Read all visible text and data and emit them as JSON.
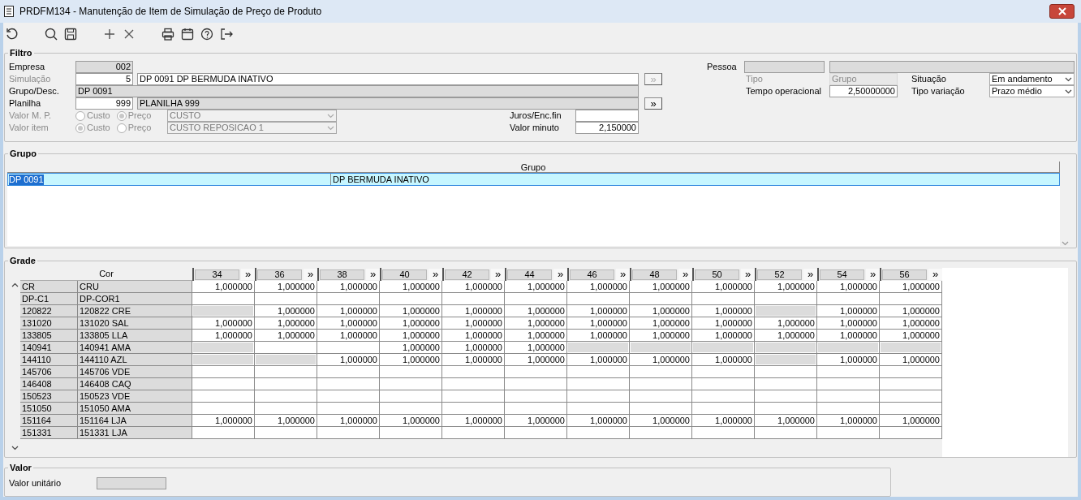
{
  "window": {
    "title": "PRDFM134 - Manutenção de Item de Simulação de Preço de Produto"
  },
  "filtro": {
    "title": "Filtro",
    "empresa": {
      "label": "Empresa",
      "value": "002",
      "disabled": false
    },
    "simulacao": {
      "label": "Simulação",
      "disabled": true,
      "value": "5",
      "description": "DP 0091 DP BERMUDA INATIVO",
      "button": {
        "label": "»",
        "disabled": true
      }
    },
    "grupo": {
      "label": "Grupo/Desc.",
      "disabled": false,
      "value": "DP 0091"
    },
    "planilha": {
      "label": "Planilha",
      "disabled": false,
      "value": "999",
      "description": "PLANILHA 999",
      "button": {
        "label": "»",
        "disabled": false
      }
    },
    "valor_mp": {
      "label": "Valor M. P.",
      "disabled": true,
      "options": [
        {
          "label": "Custo",
          "selected": false
        },
        {
          "label": "Preço",
          "selected": true
        }
      ],
      "dropdown": "CUSTO"
    },
    "valor_item": {
      "label": "Valor item",
      "disabled": true,
      "options": [
        {
          "label": "Custo",
          "selected": true
        },
        {
          "label": "Preço",
          "selected": false
        }
      ],
      "dropdown": "CUSTO REPOSICAO 1"
    },
    "juros": {
      "label": "Juros/Enc.fin"
    },
    "valor_minuto": {
      "label": "Valor minuto",
      "value": "2,150000"
    },
    "pessoa": {
      "label": "Pessoa"
    },
    "tipo": {
      "label": "Tipo",
      "disabled": true,
      "value": "Grupo"
    },
    "situacao": {
      "label": "Situação",
      "value": "Em andamento"
    },
    "tempo_operacional": {
      "label": "Tempo operacional",
      "value": "2,50000000"
    },
    "tipo_variacao": {
      "label": "Tipo variação",
      "value": "Prazo médio"
    }
  },
  "grupo": {
    "title": "Grupo",
    "header": "Grupo",
    "rows": [
      {
        "selected": true,
        "cells": [
          "DP 0091",
          "DP BERMUDA INATIVO"
        ]
      }
    ]
  },
  "grade": {
    "title": "Grade",
    "name_header": "Cor",
    "sizes": [
      {
        "label": "34",
        "button": "»"
      },
      {
        "label": "36",
        "button": "»"
      },
      {
        "label": "38",
        "button": "»"
      },
      {
        "label": "40",
        "button": "»"
      },
      {
        "label": "42",
        "button": "»"
      },
      {
        "label": "44",
        "button": "»"
      },
      {
        "label": "46",
        "button": "»"
      },
      {
        "label": "48",
        "button": "»"
      },
      {
        "label": "50",
        "button": "»"
      },
      {
        "label": "52",
        "button": "»"
      },
      {
        "label": "54",
        "button": "»"
      },
      {
        "label": "56",
        "button": "»"
      }
    ],
    "rows": [
      {
        "code": "CR",
        "name": "CRU",
        "cells": [
          {
            "value": "1,000000",
            "disabled": false
          },
          {
            "value": "1,000000",
            "disabled": false
          },
          {
            "value": "1,000000",
            "disabled": false
          },
          {
            "value": "1,000000",
            "disabled": false
          },
          {
            "value": "1,000000",
            "disabled": false
          },
          {
            "value": "1,000000",
            "disabled": false
          },
          {
            "value": "1,000000",
            "disabled": false
          },
          {
            "value": "1,000000",
            "disabled": false
          },
          {
            "value": "1,000000",
            "disabled": false
          },
          {
            "value": "1,000000",
            "disabled": false
          },
          {
            "value": "1,000000",
            "disabled": false
          },
          {
            "value": "1,000000",
            "disabled": false
          }
        ]
      },
      {
        "code": "DP-C1",
        "name": "DP-COR1",
        "cells": [
          {
            "disabled": false
          },
          {
            "disabled": false
          },
          {
            "disabled": false
          },
          {
            "disabled": false
          },
          {
            "disabled": false
          },
          {
            "disabled": false
          },
          {
            "disabled": false
          },
          {
            "disabled": false
          },
          {
            "disabled": false
          },
          {
            "disabled": false
          },
          {
            "disabled": false
          },
          {
            "disabled": false
          }
        ]
      },
      {
        "code": "120822",
        "name": "120822 CRE",
        "cells": [
          {
            "disabled": true
          },
          {
            "value": "1,000000",
            "disabled": false
          },
          {
            "value": "1,000000",
            "disabled": false
          },
          {
            "value": "1,000000",
            "disabled": false
          },
          {
            "value": "1,000000",
            "disabled": false
          },
          {
            "value": "1,000000",
            "disabled": false
          },
          {
            "value": "1,000000",
            "disabled": false
          },
          {
            "value": "1,000000",
            "disabled": false
          },
          {
            "value": "1,000000",
            "disabled": false
          },
          {
            "disabled": true
          },
          {
            "value": "1,000000",
            "disabled": false
          },
          {
            "value": "1,000000",
            "disabled": false
          }
        ]
      },
      {
        "code": "131020",
        "name": "131020 SAL",
        "cells": [
          {
            "value": "1,000000",
            "disabled": false
          },
          {
            "value": "1,000000",
            "disabled": false
          },
          {
            "value": "1,000000",
            "disabled": false
          },
          {
            "value": "1,000000",
            "disabled": false
          },
          {
            "value": "1,000000",
            "disabled": false
          },
          {
            "value": "1,000000",
            "disabled": false
          },
          {
            "value": "1,000000",
            "disabled": false
          },
          {
            "value": "1,000000",
            "disabled": false
          },
          {
            "value": "1,000000",
            "disabled": false
          },
          {
            "value": "1,000000",
            "disabled": false
          },
          {
            "value": "1,000000",
            "disabled": false
          },
          {
            "value": "1,000000",
            "disabled": false
          }
        ]
      },
      {
        "code": "133805",
        "name": "133805 LLA",
        "cells": [
          {
            "value": "1,000000",
            "disabled": false
          },
          {
            "value": "1,000000",
            "disabled": false
          },
          {
            "value": "1,000000",
            "disabled": false
          },
          {
            "value": "1,000000",
            "disabled": false
          },
          {
            "value": "1,000000",
            "disabled": false
          },
          {
            "value": "1,000000",
            "disabled": false
          },
          {
            "value": "1,000000",
            "disabled": false
          },
          {
            "value": "1,000000",
            "disabled": false
          },
          {
            "value": "1,000000",
            "disabled": false
          },
          {
            "value": "1,000000",
            "disabled": false
          },
          {
            "value": "1,000000",
            "disabled": false
          },
          {
            "value": "1,000000",
            "disabled": false
          }
        ]
      },
      {
        "code": "140941",
        "name": "140941 AMA",
        "cells": [
          {
            "disabled": true
          },
          {
            "disabled": false
          },
          {
            "disabled": false
          },
          {
            "value": "1,000000",
            "disabled": false
          },
          {
            "value": "1,000000",
            "disabled": false
          },
          {
            "value": "1,000000",
            "disabled": false
          },
          {
            "disabled": true
          },
          {
            "disabled": true
          },
          {
            "disabled": true
          },
          {
            "disabled": true
          },
          {
            "disabled": true
          },
          {
            "disabled": true
          }
        ]
      },
      {
        "code": "144110",
        "name": "144110 AZL",
        "cells": [
          {
            "disabled": true
          },
          {
            "disabled": true
          },
          {
            "value": "1,000000",
            "disabled": false
          },
          {
            "value": "1,000000",
            "disabled": false
          },
          {
            "value": "1,000000",
            "disabled": false
          },
          {
            "value": "1,000000",
            "disabled": false
          },
          {
            "value": "1,000000",
            "disabled": false
          },
          {
            "value": "1,000000",
            "disabled": false
          },
          {
            "value": "1,000000",
            "disabled": false
          },
          {
            "disabled": true
          },
          {
            "value": "1,000000",
            "disabled": false
          },
          {
            "value": "1,000000",
            "disabled": false
          }
        ]
      },
      {
        "code": "145706",
        "name": "145706 VDE",
        "cells": [
          {
            "disabled": false
          },
          {
            "disabled": false
          },
          {
            "disabled": false
          },
          {
            "disabled": false
          },
          {
            "disabled": false
          },
          {
            "disabled": false
          },
          {
            "disabled": false
          },
          {
            "disabled": false
          },
          {
            "disabled": false
          },
          {
            "disabled": false
          },
          {
            "disabled": false
          },
          {
            "disabled": false
          }
        ]
      },
      {
        "code": "146408",
        "name": "146408 CAQ",
        "cells": [
          {
            "disabled": false
          },
          {
            "disabled": false
          },
          {
            "disabled": false
          },
          {
            "disabled": false
          },
          {
            "disabled": false
          },
          {
            "disabled": false
          },
          {
            "disabled": false
          },
          {
            "disabled": false
          },
          {
            "disabled": false
          },
          {
            "disabled": false
          },
          {
            "disabled": false
          },
          {
            "disabled": false
          }
        ]
      },
      {
        "code": "150523",
        "name": "150523 VDE",
        "cells": [
          {
            "disabled": false
          },
          {
            "disabled": false
          },
          {
            "disabled": false
          },
          {
            "disabled": false
          },
          {
            "disabled": false
          },
          {
            "disabled": false
          },
          {
            "disabled": false
          },
          {
            "disabled": false
          },
          {
            "disabled": false
          },
          {
            "disabled": false
          },
          {
            "disabled": false
          },
          {
            "disabled": false
          }
        ]
      },
      {
        "code": "151050",
        "name": "151050 AMA",
        "cells": [
          {
            "disabled": false
          },
          {
            "disabled": false
          },
          {
            "disabled": false
          },
          {
            "disabled": false
          },
          {
            "disabled": false
          },
          {
            "disabled": false
          },
          {
            "disabled": false
          },
          {
            "disabled": false
          },
          {
            "disabled": false
          },
          {
            "disabled": false
          },
          {
            "disabled": false
          },
          {
            "disabled": false
          }
        ]
      },
      {
        "code": "151164",
        "name": "151164 LJA",
        "cells": [
          {
            "value": "1,000000",
            "disabled": false
          },
          {
            "value": "1,000000",
            "disabled": false
          },
          {
            "value": "1,000000",
            "disabled": false
          },
          {
            "value": "1,000000",
            "disabled": false
          },
          {
            "value": "1,000000",
            "disabled": false
          },
          {
            "value": "1,000000",
            "disabled": false
          },
          {
            "value": "1,000000",
            "disabled": false
          },
          {
            "value": "1,000000",
            "disabled": false
          },
          {
            "value": "1,000000",
            "disabled": false
          },
          {
            "value": "1,000000",
            "disabled": false
          },
          {
            "value": "1,000000",
            "disabled": false
          },
          {
            "value": "1,000000",
            "disabled": false
          }
        ]
      },
      {
        "code": "151331",
        "name": "151331 LJA",
        "cells": [
          {
            "disabled": false
          },
          {
            "disabled": false
          },
          {
            "disabled": false
          },
          {
            "disabled": false
          },
          {
            "disabled": false
          },
          {
            "disabled": false
          },
          {
            "disabled": false
          },
          {
            "disabled": false
          },
          {
            "disabled": false
          },
          {
            "disabled": false
          },
          {
            "disabled": false
          },
          {
            "disabled": false
          }
        ]
      }
    ]
  },
  "valor": {
    "title": "Valor",
    "valor_unitario": {
      "label": "Valor unitário"
    }
  }
}
